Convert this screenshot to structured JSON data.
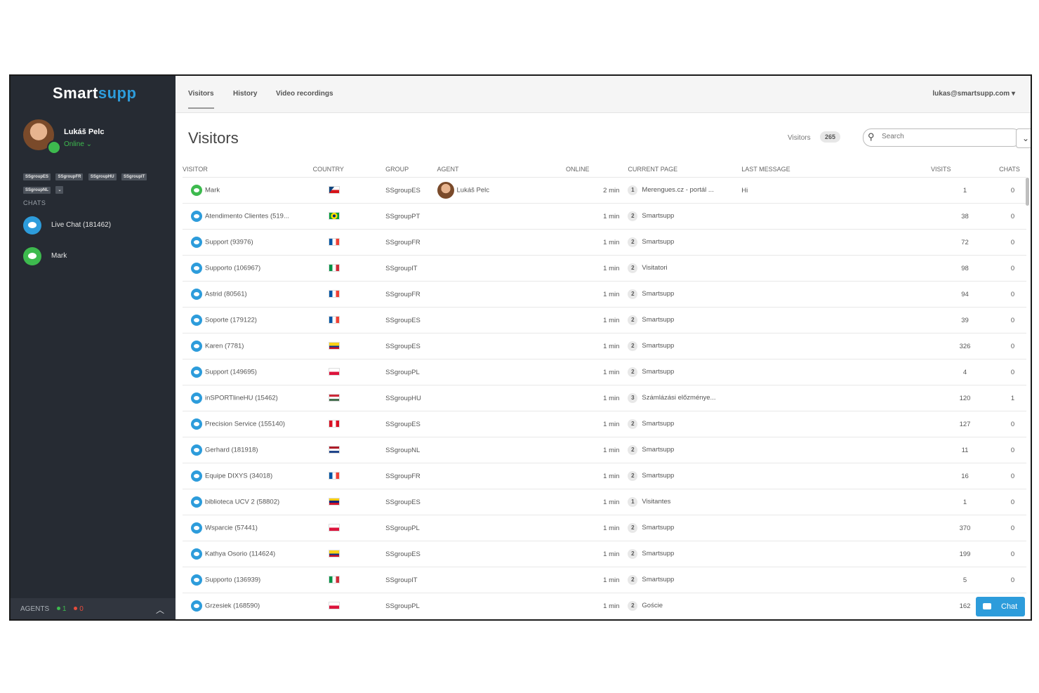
{
  "app": {
    "logo_text_1": "Smart",
    "logo_text_2": "supp"
  },
  "user": {
    "name": "Lukáš Pelc",
    "status": "Online ⌄"
  },
  "groups": [
    "SSgroupES",
    "SSgroupFR",
    "SSgroupHU",
    "SSgroupIT",
    "SSgroupNL",
    "⌄"
  ],
  "chats": {
    "title": "CHATS",
    "items": [
      {
        "label": "Live Chat (181462)"
      },
      {
        "label": "Mark"
      }
    ]
  },
  "agents": {
    "label": "AGENTS",
    "online": "1",
    "offline": "0"
  },
  "nav": {
    "tabs": [
      "Visitors",
      "History",
      "Video recordings"
    ],
    "account": "lukas@smartsupp.com ▾"
  },
  "page": {
    "title": "Visitors",
    "count_label": "Visitors",
    "count": "265"
  },
  "search": {
    "placeholder": "Search"
  },
  "table": {
    "headers": [
      "VISITOR",
      "COUNTRY",
      "GROUP",
      "AGENT",
      "ONLINE",
      "CURRENT PAGE",
      "LAST MESSAGE",
      "VISITS",
      "CHATS"
    ],
    "rows": [
      {
        "visitor": "Mark",
        "group": "SSgroupES",
        "agent": "Lukáš Pelc",
        "online": "2 min",
        "pages": "1",
        "page": "Merengues.cz - portál ...",
        "message": "Hi",
        "visits": "1",
        "chats": "0"
      },
      {
        "visitor": "Atendimento Clientes (519...",
        "group": "SSgroupPT",
        "agent": "",
        "online": "1 min",
        "pages": "2",
        "page": "Smartsupp",
        "message": "",
        "visits": "38",
        "chats": "0"
      },
      {
        "visitor": "Support (93976)",
        "group": "SSgroupFR",
        "agent": "",
        "online": "1 min",
        "pages": "2",
        "page": "Smartsupp",
        "message": "",
        "visits": "72",
        "chats": "0"
      },
      {
        "visitor": "Supporto (106967)",
        "group": "SSgroupIT",
        "agent": "",
        "online": "1 min",
        "pages": "2",
        "page": "Visitatori",
        "message": "",
        "visits": "98",
        "chats": "0"
      },
      {
        "visitor": "Astrid (80561)",
        "group": "SSgroupFR",
        "agent": "",
        "online": "1 min",
        "pages": "2",
        "page": "Smartsupp",
        "message": "",
        "visits": "94",
        "chats": "0"
      },
      {
        "visitor": "Soporte (179122)",
        "group": "SSgroupES",
        "agent": "",
        "online": "1 min",
        "pages": "2",
        "page": "Smartsupp",
        "message": "",
        "visits": "39",
        "chats": "0"
      },
      {
        "visitor": "Karen (7781)",
        "group": "SSgroupES",
        "agent": "",
        "online": "1 min",
        "pages": "2",
        "page": "Smartsupp",
        "message": "",
        "visits": "326",
        "chats": "0"
      },
      {
        "visitor": "Support (149695)",
        "group": "SSgroupPL",
        "agent": "",
        "online": "1 min",
        "pages": "2",
        "page": "Smartsupp",
        "message": "",
        "visits": "4",
        "chats": "0"
      },
      {
        "visitor": "inSPORTlineHU (15462)",
        "group": "SSgroupHU",
        "agent": "",
        "online": "1 min",
        "pages": "3",
        "page": "Számlázási előzménye...",
        "message": "",
        "visits": "120",
        "chats": "1"
      },
      {
        "visitor": "Precision Service (155140)",
        "group": "SSgroupES",
        "agent": "",
        "online": "1 min",
        "pages": "2",
        "page": "Smartsupp",
        "message": "",
        "visits": "127",
        "chats": "0"
      },
      {
        "visitor": "Gerhard (181918)",
        "group": "SSgroupNL",
        "agent": "",
        "online": "1 min",
        "pages": "2",
        "page": "Smartsupp",
        "message": "",
        "visits": "11",
        "chats": "0"
      },
      {
        "visitor": "Equipe DIXYS (34018)",
        "group": "SSgroupFR",
        "agent": "",
        "online": "1 min",
        "pages": "2",
        "page": "Smartsupp",
        "message": "",
        "visits": "16",
        "chats": "0"
      },
      {
        "visitor": "biblioteca UCV 2 (58802)",
        "group": "SSgroupES",
        "agent": "",
        "online": "1 min",
        "pages": "1",
        "page": "Visitantes",
        "message": "",
        "visits": "1",
        "chats": "0"
      },
      {
        "visitor": "Wsparcie (57441)",
        "group": "SSgroupPL",
        "agent": "",
        "online": "1 min",
        "pages": "2",
        "page": "Smartsupp",
        "message": "",
        "visits": "370",
        "chats": "0"
      },
      {
        "visitor": "Kathya Osorio (114624)",
        "group": "SSgroupES",
        "agent": "",
        "online": "1 min",
        "pages": "2",
        "page": "Smartsupp",
        "message": "",
        "visits": "199",
        "chats": "0"
      },
      {
        "visitor": "Supporto (136939)",
        "group": "SSgroupIT",
        "agent": "",
        "online": "1 min",
        "pages": "2",
        "page": "Smartsupp",
        "message": "",
        "visits": "5",
        "chats": "0"
      },
      {
        "visitor": "Grzesiek (168590)",
        "group": "SSgroupPL",
        "agent": "",
        "online": "1 min",
        "pages": "2",
        "page": "Goście",
        "message": "",
        "visits": "162",
        "chats": ""
      }
    ]
  },
  "flags": [
    "cz",
    "br",
    "fr",
    "it",
    "fr",
    "fr",
    "co",
    "pl",
    "hu",
    "pe",
    "nl",
    "fr",
    "ve",
    "pl",
    "co",
    "it",
    "pl"
  ],
  "chat_button": {
    "label": "Chat"
  },
  "colors": {
    "sidebar": "#262b33",
    "accent": "#2d9cdb",
    "online": "#3dba4e"
  }
}
